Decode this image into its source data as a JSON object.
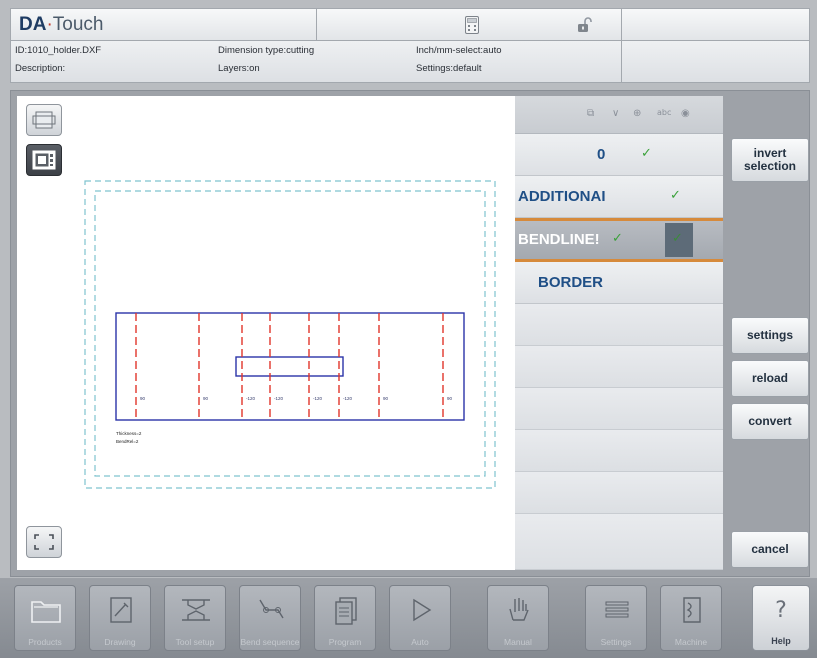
{
  "header": {
    "brand_a": "DA",
    "brand_dot": "·",
    "brand_b": "Touch",
    "file_id": "ID:1010_holder.DXF",
    "description": "Description:",
    "dimension_type": "Dimension type:cutting",
    "layers": "Layers:on",
    "inch_mm": "Inch/mm-select:auto",
    "settings": "Settings:default"
  },
  "canvas": {
    "thickness_label": "Thickness=2",
    "note_label": "BendRel=2",
    "bend_labels": [
      "90",
      "90",
      "-120",
      "-120",
      "-120",
      "-120",
      "90",
      "90"
    ]
  },
  "layers": {
    "header_icons": [
      "copy-icon",
      "chevron-down-icon",
      "target-icon",
      "abc-icon",
      "eye-icon"
    ],
    "items": [
      {
        "name": "0",
        "checked": true,
        "selected": false
      },
      {
        "name": "ADDITIONAI",
        "checked": true,
        "selected": false
      },
      {
        "name": "BENDLINE!",
        "checked": true,
        "selected": true
      },
      {
        "name": "BORDER",
        "checked": false,
        "selected": false
      }
    ],
    "check_glyph": "✓"
  },
  "actions": {
    "invert_selection": "invert selection",
    "settings": "settings",
    "reload": "reload",
    "convert": "convert",
    "cancel": "cancel"
  },
  "nav": [
    {
      "label": "Products",
      "icon": "folder-icon"
    },
    {
      "label": "Drawing",
      "icon": "drawing-icon"
    },
    {
      "label": "Tool setup",
      "icon": "tool-setup-icon"
    },
    {
      "label": "Bend sequence",
      "icon": "bend-sequence-icon"
    },
    {
      "label": "Program",
      "icon": "program-icon"
    },
    {
      "label": "Auto",
      "icon": "play-icon"
    },
    {
      "label": "Manual",
      "icon": "hand-icon"
    },
    {
      "label": "Settings",
      "icon": "settings-list-icon"
    },
    {
      "label": "Machine",
      "icon": "machine-icon"
    }
  ],
  "help": {
    "label": "Help",
    "glyph": "?"
  }
}
